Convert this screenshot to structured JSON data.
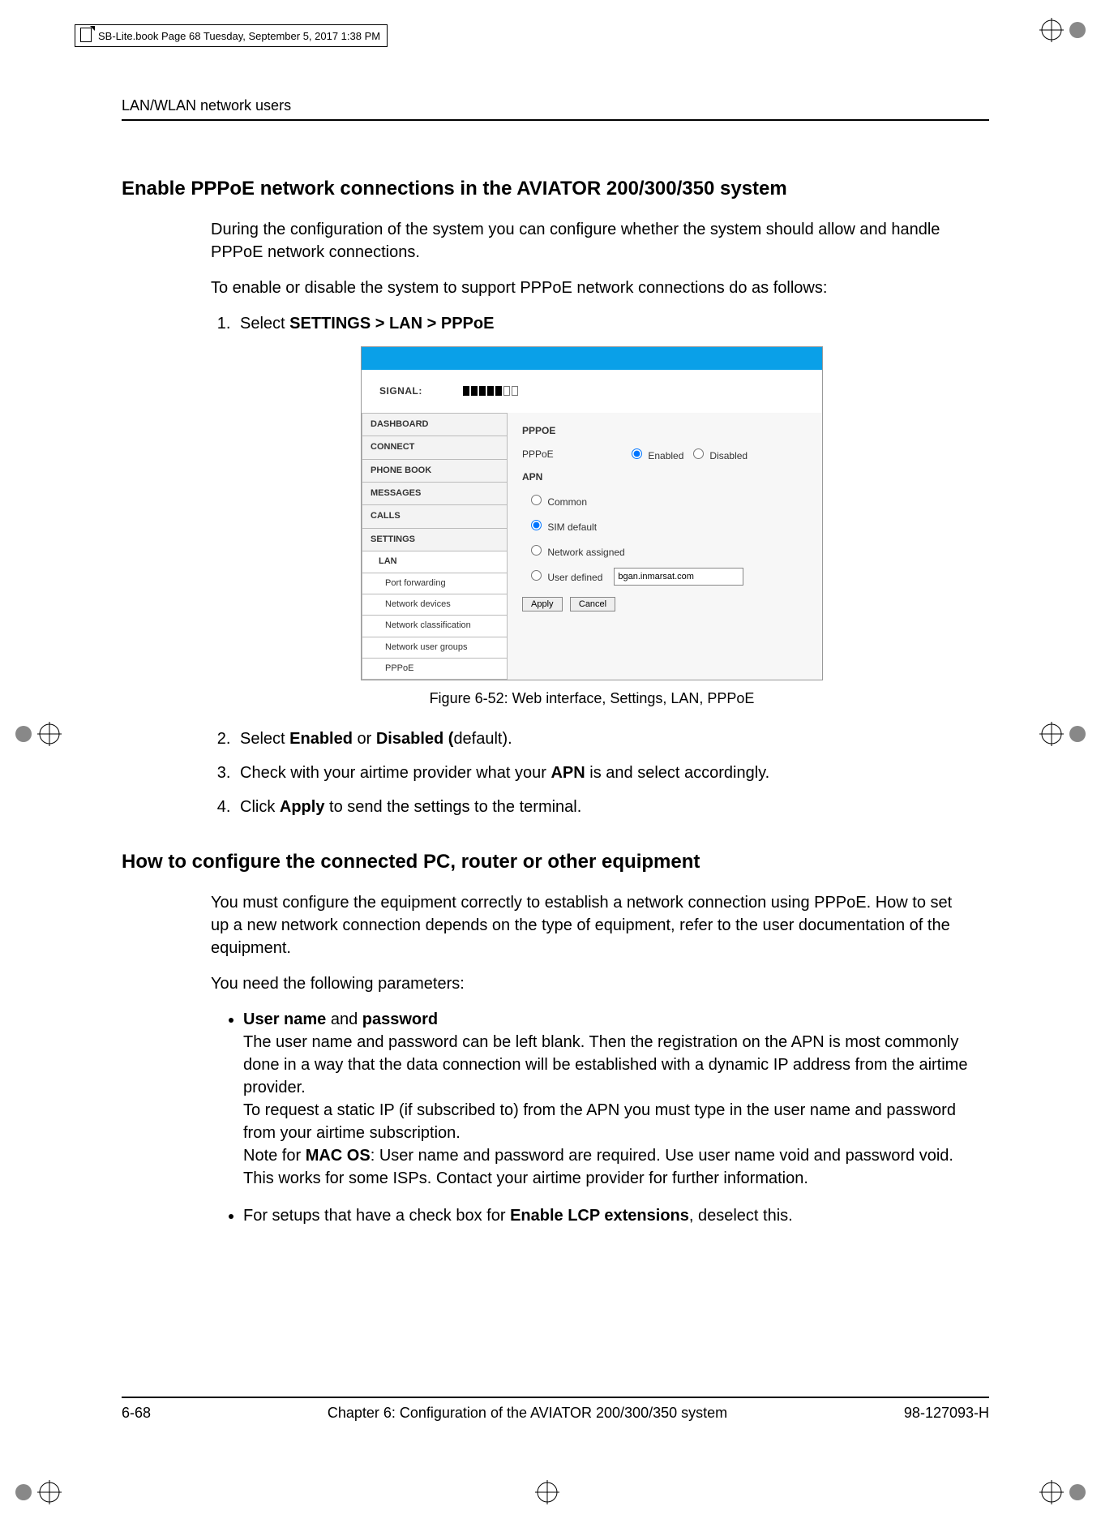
{
  "print_header": "SB-Lite.book  Page 68  Tuesday, September 5, 2017  1:38 PM",
  "running_head": "LAN/WLAN network users",
  "sec1_title": "Enable PPPoE network connections in the AVIATOR 200/300/350 system",
  "sec1_p1": "During the configuration of the system you can configure whether the system should allow and handle PPPoE network connections.",
  "sec1_p2": "To enable or disable the system to support PPPoE network connections do as follows:",
  "step1_pre": "Select ",
  "step1_bold": "SETTINGS > LAN > PPPoE",
  "webif": {
    "signal_label": "SIGNAL:",
    "nav": {
      "dashboard": "DASHBOARD",
      "connect": "CONNECT",
      "phonebook": "PHONE BOOK",
      "messages": "MESSAGES",
      "calls": "CALLS",
      "settings": "SETTINGS",
      "lan": "LAN",
      "port_fwd": "Port forwarding",
      "net_dev": "Network devices",
      "net_class": "Network classification",
      "net_user_groups": "Network user groups",
      "pppoe": "PPPoE"
    },
    "pane": {
      "pppoe_title": "PPPOE",
      "pppoe_label": "PPPoE",
      "enabled": "Enabled",
      "disabled": "Disabled",
      "apn_title": "APN",
      "opt_common": "Common",
      "opt_sim": "SIM default",
      "opt_net": "Network assigned",
      "opt_user": "User defined",
      "user_value": "bgan.inmarsat.com",
      "apply": "Apply",
      "cancel": "Cancel"
    }
  },
  "fig_caption": "Figure 6-52: Web interface, Settings, LAN, PPPoE",
  "step2_a": "Select ",
  "step2_b1": "Enabled",
  "step2_mid": " or ",
  "step2_b2": "Disabled (",
  "step2_tail": "default).",
  "step3_a": "Check with your airtime provider what your ",
  "step3_b": "APN",
  "step3_tail": " is and select accordingly.",
  "step4_a": "Click ",
  "step4_b": "Apply",
  "step4_tail": " to send the settings to the terminal.",
  "sec2_title": "How to configure the connected PC, router or other equipment",
  "sec2_p1": "You must configure the equipment correctly to establish a network connection using PPPoE. How to set up a new network connection depends on the type of equipment, refer to the user documentation of the equipment.",
  "sec2_p2": "You need the following parameters:",
  "bullet1_b1": "User name",
  "bullet1_mid": " and ",
  "bullet1_b2": "password",
  "bullet1_body1": "The user name and password can be left blank. Then the registration on the APN is most commonly done in a way that the data connection will be established with a dynamic IP address from the airtime provider.",
  "bullet1_body2": "To request a static IP (if subscribed to) from the APN you must type in the user name and password from your airtime subscription.",
  "bullet1_body3_a": "Note for ",
  "bullet1_body3_b": "MAC OS",
  "bullet1_body3_c": ": User name and password are required. Use user name void and password void. This works for some ISPs. Contact your airtime provider for further information.",
  "bullet2_a": "For setups that have a check box for ",
  "bullet2_b": "Enable LCP extensions",
  "bullet2_c": ", deselect this.",
  "footer": {
    "page": "6-68",
    "chapter": "Chapter 6:  Configuration of the AVIATOR 200/300/350 system",
    "docnum": "98-127093-H"
  }
}
